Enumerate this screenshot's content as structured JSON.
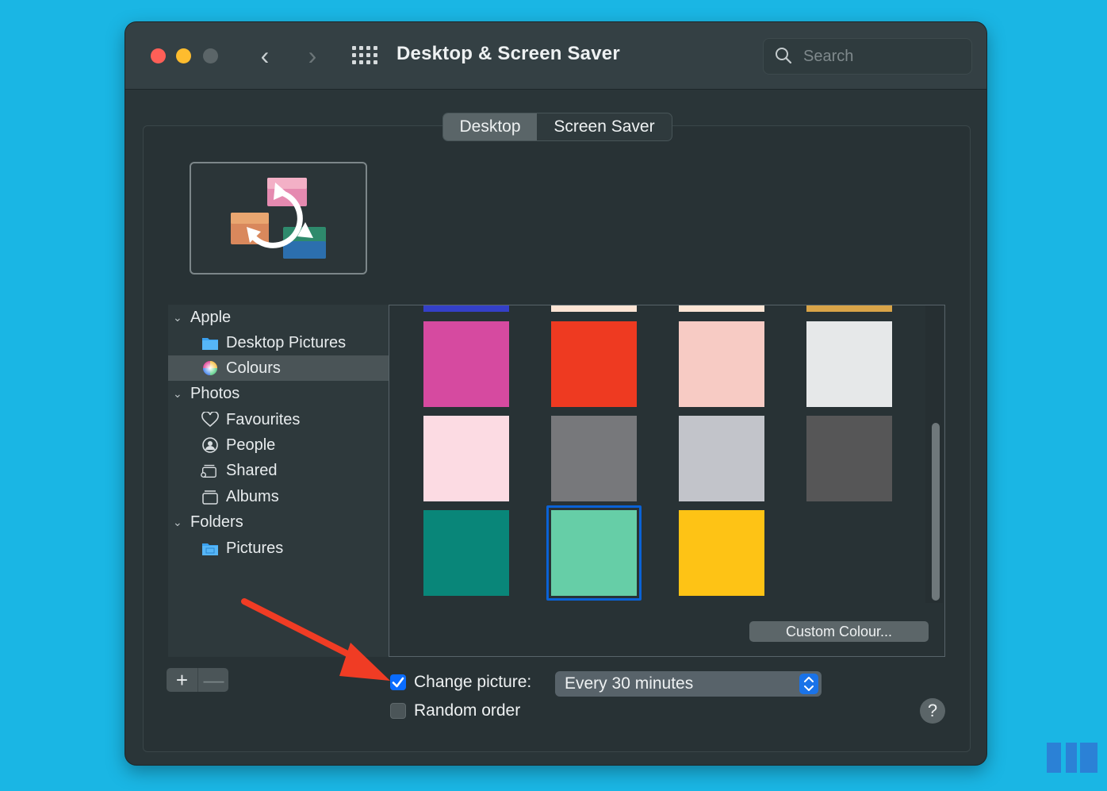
{
  "window": {
    "title": "Desktop & Screen Saver",
    "search_placeholder": "Search"
  },
  "tabs": [
    {
      "label": "Desktop",
      "selected": true
    },
    {
      "label": "Screen Saver",
      "selected": false
    }
  ],
  "sidebar": {
    "groups": [
      {
        "label": "Apple",
        "items": [
          {
            "label": "Desktop Pictures",
            "icon": "folder-icon"
          },
          {
            "label": "Colours",
            "icon": "color-wheel-icon",
            "selected": true
          }
        ]
      },
      {
        "label": "Photos",
        "items": [
          {
            "label": "Favourites",
            "icon": "heart-icon"
          },
          {
            "label": "People",
            "icon": "person-circle-icon"
          },
          {
            "label": "Shared",
            "icon": "shared-album-icon"
          },
          {
            "label": "Albums",
            "icon": "albums-icon"
          }
        ]
      },
      {
        "label": "Folders",
        "items": [
          {
            "label": "Pictures",
            "icon": "pictures-folder-icon"
          }
        ]
      }
    ]
  },
  "colours": {
    "top_row_partial": [
      "#3440c8",
      "#fde4d4",
      "#fde4d4",
      "#d9a448"
    ],
    "rows": [
      [
        "#d64aa0",
        "#ee3a21",
        "#f7cbc4",
        "#e6e8e9"
      ],
      [
        "#fcdbe3",
        "#77787b",
        "#c2c4ca",
        "#565657"
      ],
      [
        "#098679",
        "#66cea7",
        "#fec315"
      ]
    ],
    "selected": {
      "row": 2,
      "col": 1
    },
    "custom_button": "Custom Colour..."
  },
  "controls": {
    "change_picture_label": "Change picture:",
    "change_picture_checked": true,
    "interval": "Every 30 minutes",
    "random_order_label": "Random order",
    "random_order_checked": false,
    "add_label": "+",
    "remove_label": "—",
    "help_label": "?"
  },
  "colors": {
    "accent": "#0a6cff",
    "annotation_arrow": "#f03c24",
    "background": "#1ab6e4"
  }
}
